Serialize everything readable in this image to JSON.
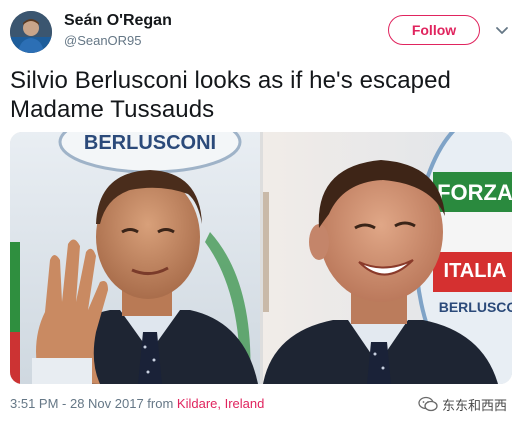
{
  "user": {
    "display_name": "Seán O'Regan",
    "handle": "@SeanOR95",
    "avatar_icon": "user-avatar"
  },
  "actions": {
    "follow_label": "Follow",
    "menu_icon": "chevron-down-icon"
  },
  "tweet": {
    "text": "Silvio Berlusconi looks as if he's escaped Madame Tussauds"
  },
  "media": {
    "left_banner_text": "BERLUSCONI",
    "right_banner_text_1": "FORZA",
    "right_banner_text_2": "ITALIA",
    "right_banner_text_3": "BERLUSCONI"
  },
  "footer": {
    "timestamp": "3:51 PM - 28 Nov 2017 from ",
    "location": "Kildare, Ireland"
  },
  "watermark": {
    "text": "东东和西西",
    "icon": "wechat-icon"
  },
  "colors": {
    "accent": "#e0245e",
    "secondary_text": "#657786",
    "primary_text": "#14171a"
  }
}
